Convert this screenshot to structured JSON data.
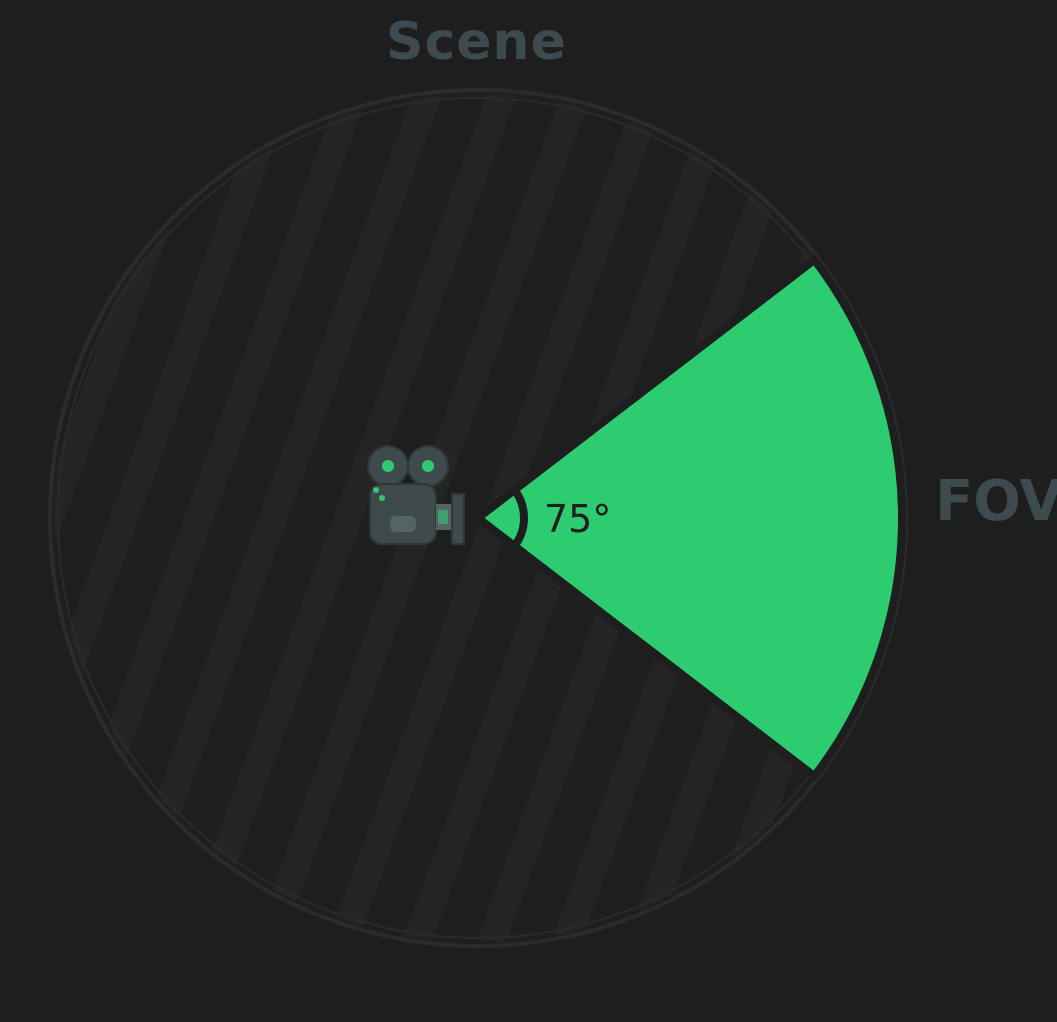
{
  "labels": {
    "scene": "Scene",
    "fov": "FOV",
    "angle": "75°"
  },
  "diagram": {
    "fov_degrees": 75,
    "camera_icon": "movie-camera-icon"
  },
  "colors": {
    "background": "#1e1e1e",
    "fov_fill": "#2ecc71",
    "label_text": "#3d4a4f",
    "circle_stroke": "#2a2a2a",
    "stripe": "#252525"
  }
}
